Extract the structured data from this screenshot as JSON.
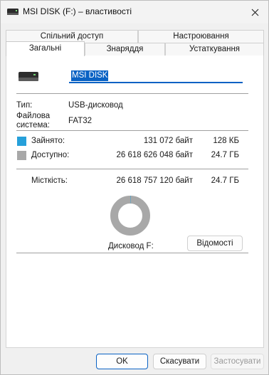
{
  "window": {
    "title": "MSI DISK (F:) – властивості",
    "close_label": "✕"
  },
  "tabs": {
    "row1": [
      {
        "label": "Спільний доступ"
      },
      {
        "label": "Настроювання"
      }
    ],
    "row2": [
      {
        "label": "Загальні",
        "active": true
      },
      {
        "label": "Знаряддя"
      },
      {
        "label": "Устаткування"
      }
    ]
  },
  "general": {
    "drive_name": "MSI DISK",
    "type_label": "Тип:",
    "type_value": "USB-дисковод",
    "fs_label": "Файлова система:",
    "fs_value": "FAT32",
    "used": {
      "label": "Зайнято:",
      "bytes": "131 072 байт",
      "size": "128 КБ",
      "color": "#26a0da"
    },
    "free": {
      "label": "Доступно:",
      "bytes": "26 618 626 048 байт",
      "size": "24.7 ГБ",
      "color": "#a8a8a8"
    },
    "capacity": {
      "label": "Місткість:",
      "bytes": "26 618 757 120 байт",
      "size": "24.7 ГБ"
    },
    "usage_fraction": 4.9e-06,
    "drive_label": "Дисковод F:",
    "details_button": "Відомості"
  },
  "footer": {
    "ok": "OK",
    "cancel": "Скасувати",
    "apply": "Застосувати"
  },
  "icons": {
    "title": "drive-icon",
    "general": "usb-drive-icon"
  }
}
